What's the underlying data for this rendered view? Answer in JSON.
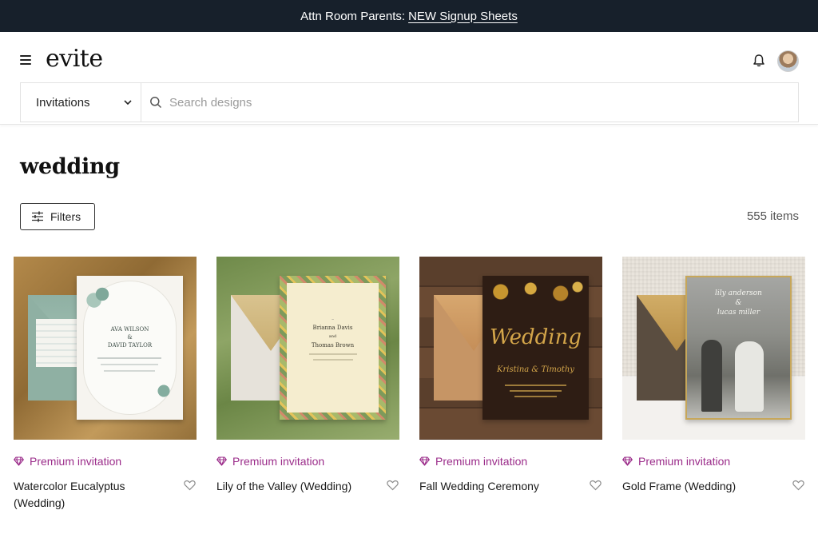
{
  "announcement": {
    "text": "Attn Room Parents:",
    "link": "NEW Signup Sheets"
  },
  "header": {
    "logo": "evite",
    "menu_icon": "hamburger-menu-icon",
    "notification_icon": "bell-icon"
  },
  "search": {
    "category": "Invitations",
    "placeholder": "Search designs"
  },
  "page": {
    "title": "wedding",
    "filters_label": "Filters",
    "item_count": "555 items"
  },
  "cards": [
    {
      "badge": "Premium invitation",
      "name": "Watercolor Eucalyptus (Wedding)",
      "invite_text": [
        "Ava Wilson",
        "&",
        "David Taylor"
      ]
    },
    {
      "badge": "Premium invitation",
      "name": "Lily of the Valley (Wedding)",
      "invite_text": [
        "Brianna Davis",
        "and",
        "Thomas Brown"
      ]
    },
    {
      "badge": "Premium invitation",
      "name": "Fall Wedding Ceremony",
      "invite_text": [
        "Wedding",
        "Kristina & Timothy"
      ]
    },
    {
      "badge": "Premium invitation",
      "name": "Gold Frame (Wedding)",
      "invite_text": [
        "lily anderson",
        "&",
        "lucas miller"
      ]
    }
  ],
  "colors": {
    "announcement_bg": "#17202b",
    "premium_accent": "#9b2c8a"
  }
}
